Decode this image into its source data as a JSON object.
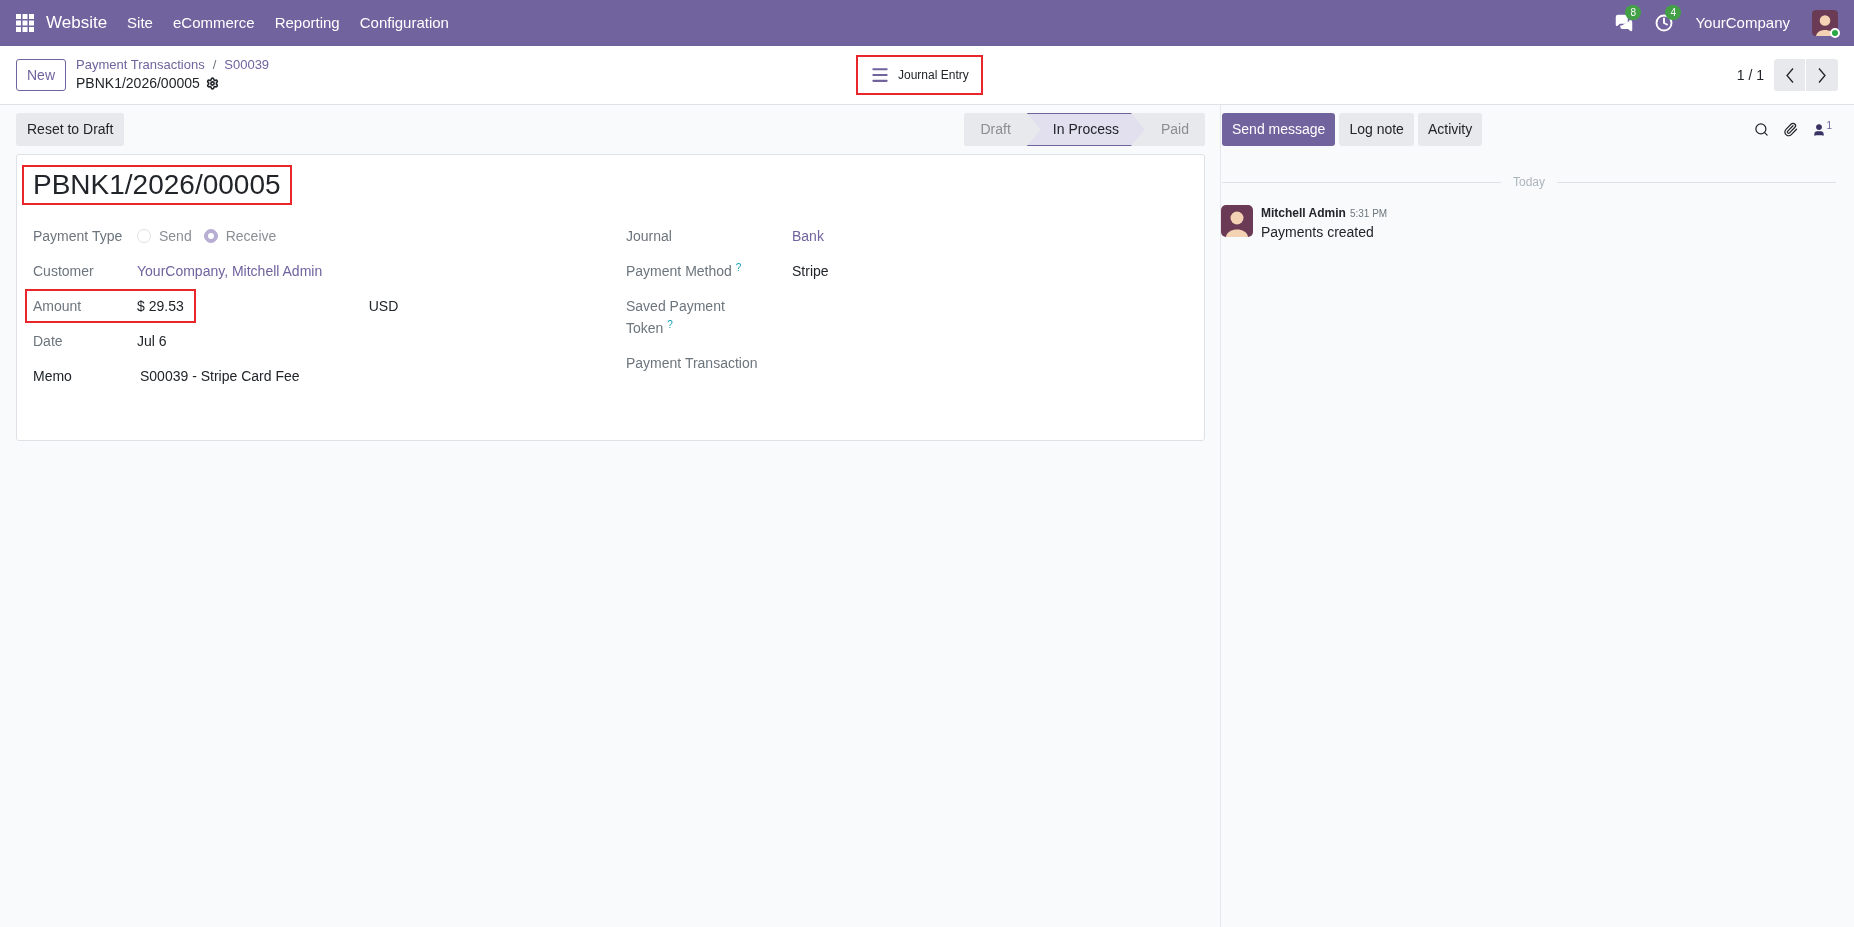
{
  "navbar": {
    "app": "Website",
    "menu": [
      "Site",
      "eCommerce",
      "Reporting",
      "Configuration"
    ],
    "messages_badge": "8",
    "activities_badge": "4",
    "company": "YourCompany"
  },
  "control_panel": {
    "new_button": "New",
    "breadcrumbs": [
      "Payment Transactions",
      "S00039"
    ],
    "breadcrumb_separator": "/",
    "record": "PBNK1/2026/00005",
    "smart_button": {
      "label": "Journal Entry",
      "highlighted": true
    },
    "pager": "1 / 1"
  },
  "actions": [
    "Reset to Draft"
  ],
  "statusbar": [
    {
      "label": "Draft",
      "selected": false
    },
    {
      "label": "In Process",
      "selected": true
    },
    {
      "label": "Paid",
      "selected": false
    }
  ],
  "form": {
    "title": {
      "text": "PBNK1/2026/00005",
      "highlighted": true
    },
    "left_fields": [
      {
        "kind": "radio",
        "label": "Payment Type",
        "options": [
          {
            "label": "Send",
            "selected": false
          },
          {
            "label": "Receive",
            "selected": true
          }
        ]
      },
      {
        "kind": "link",
        "label": "Customer",
        "value": "YourCompany, Mitchell Admin"
      },
      {
        "kind": "amount",
        "label": "Amount",
        "value": "$ 29.53",
        "currency": "USD",
        "highlighted": true
      },
      {
        "kind": "text",
        "label": "Date",
        "value": "Jul 6"
      },
      {
        "kind": "memo",
        "label": "Memo",
        "value": "S00039 - Stripe Card Fee"
      }
    ],
    "right_fields": [
      {
        "kind": "link",
        "label": "Journal",
        "value": "Bank"
      },
      {
        "kind": "text",
        "label": "Payment Method",
        "help": "?",
        "value": "Stripe"
      },
      {
        "kind": "text",
        "label": "Saved Payment Token",
        "help": "?"
      },
      {
        "kind": "text",
        "label": "Payment Transaction"
      }
    ]
  },
  "chatter": {
    "buttons": [
      {
        "label": "Send message",
        "selected": true
      },
      {
        "label": "Log note",
        "selected": false
      },
      {
        "label": "Activity",
        "selected": false
      }
    ],
    "followers_count": "1",
    "date_separator": "Today",
    "messages": [
      {
        "author": "Mitchell Admin",
        "time": "5:31 PM",
        "body": "Payments created"
      }
    ]
  }
}
